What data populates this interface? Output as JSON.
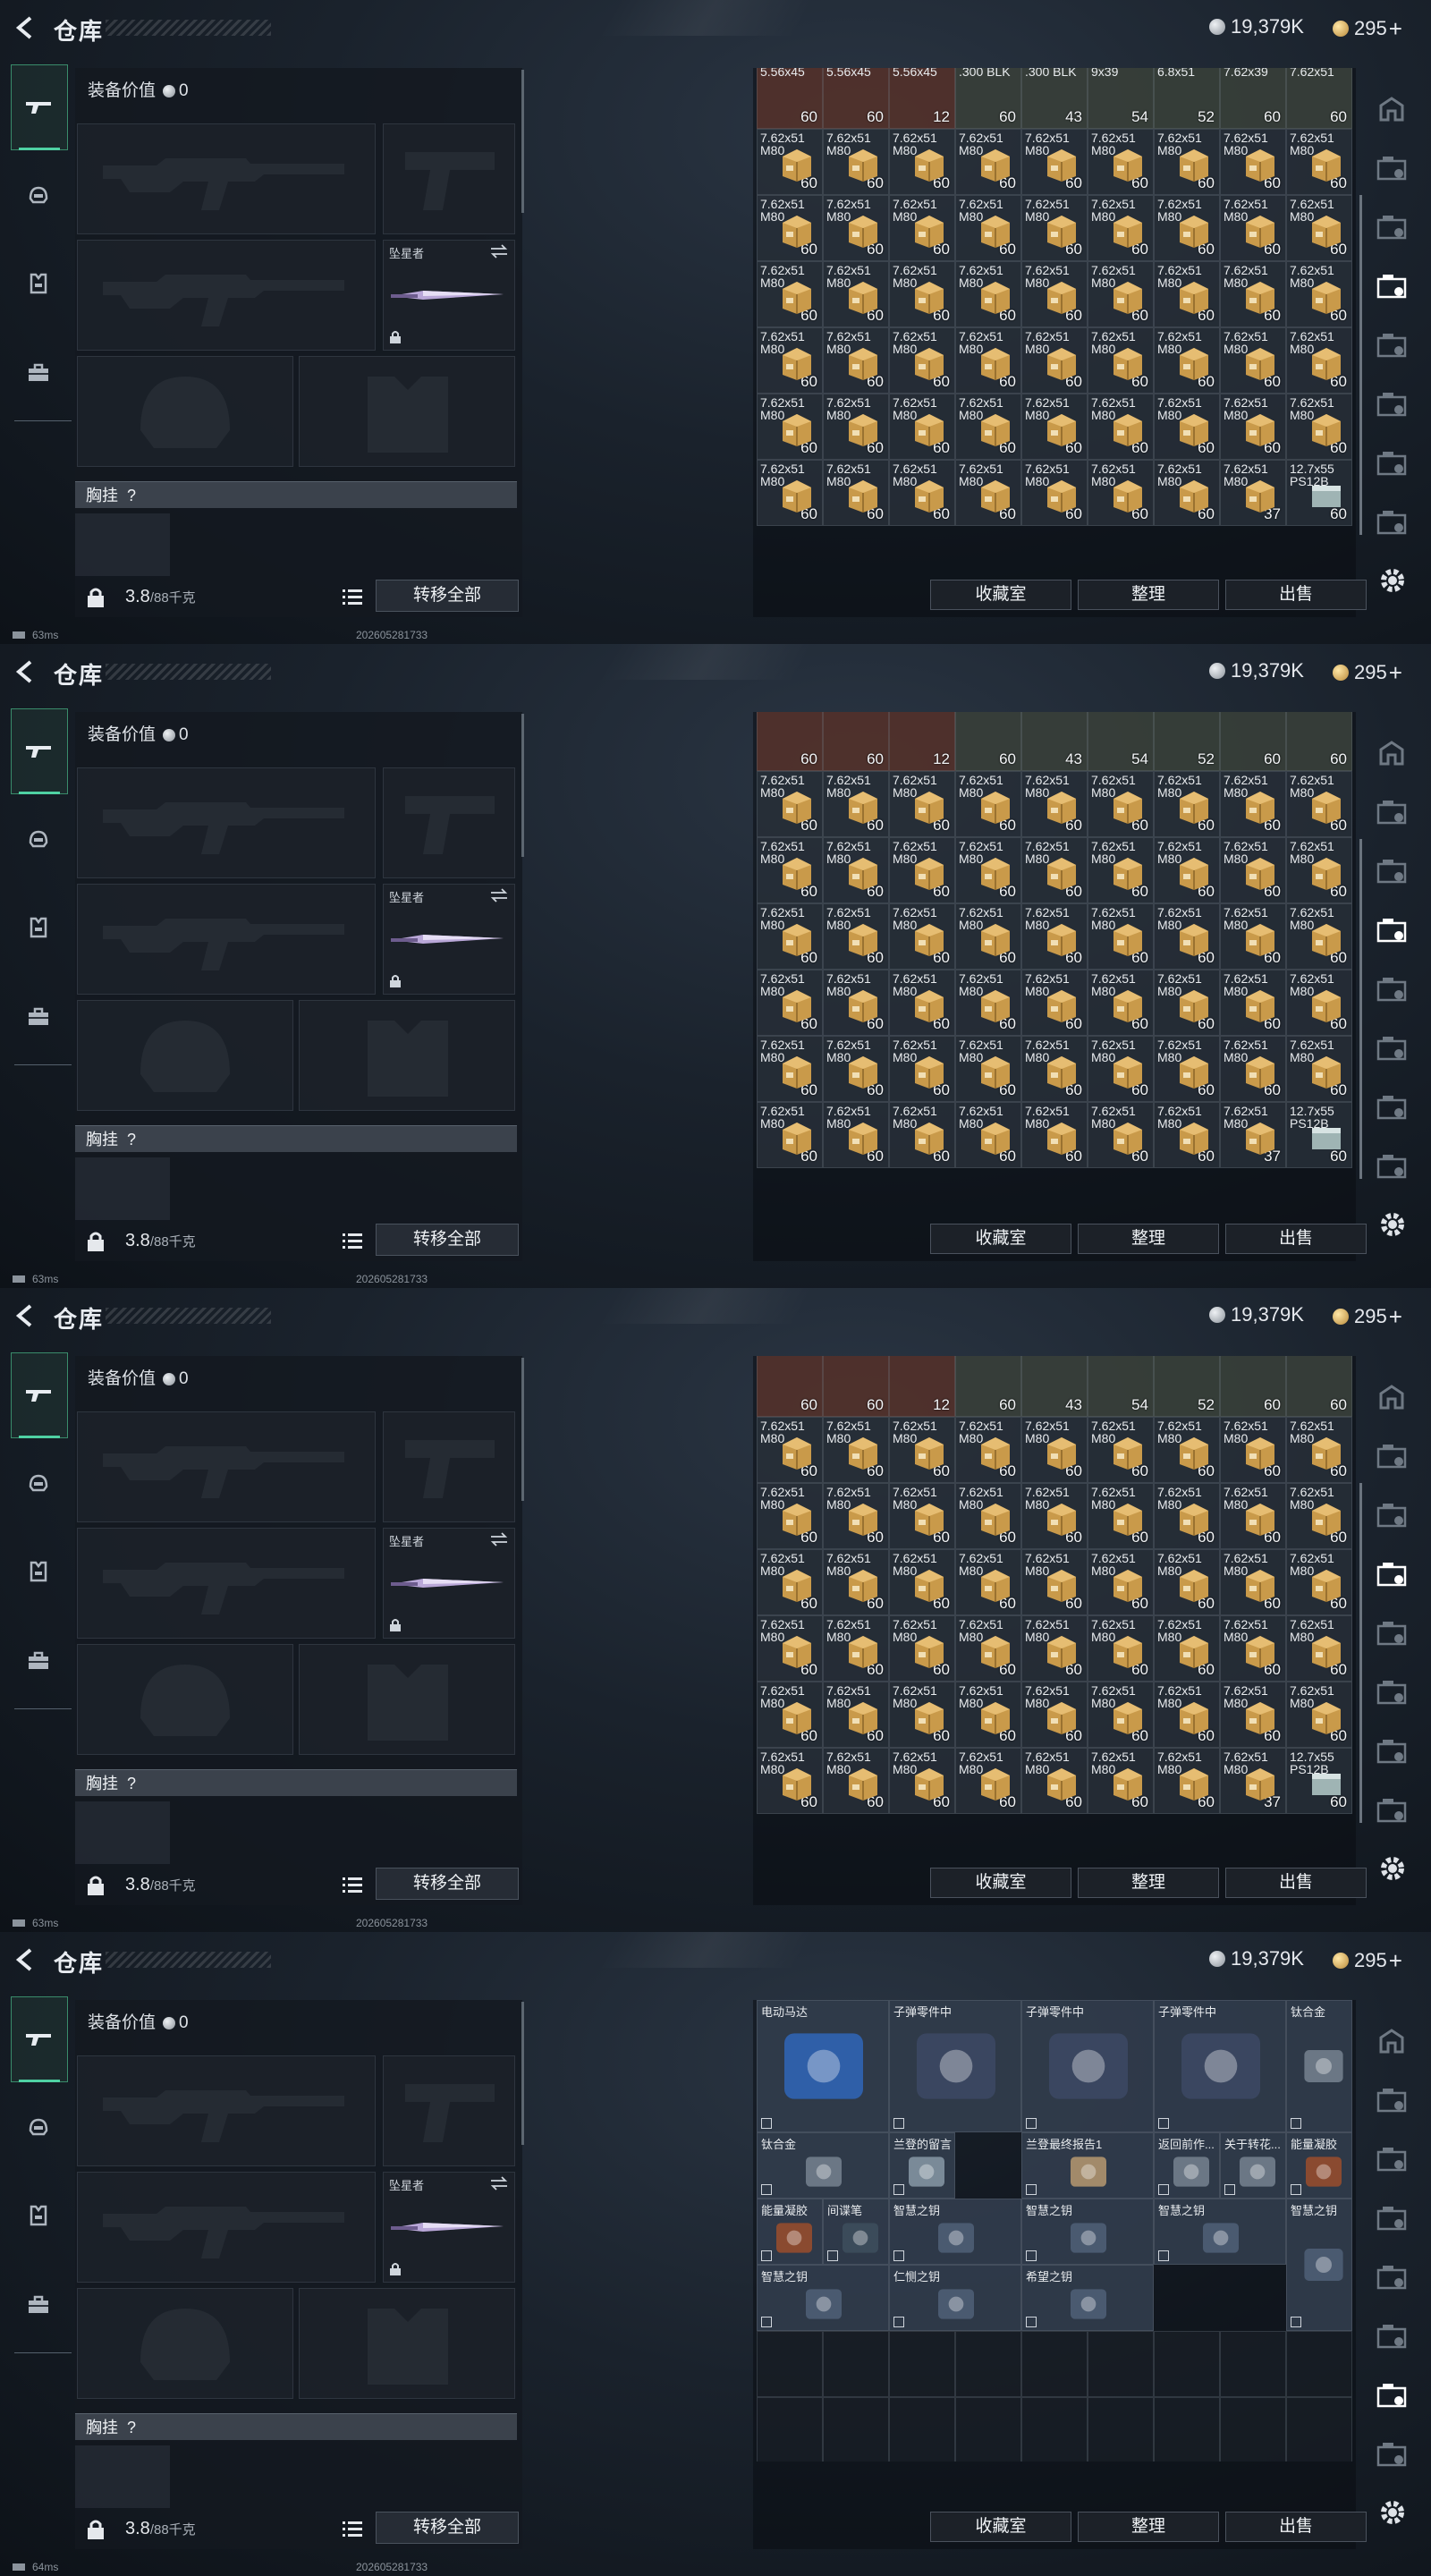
{
  "header": {
    "title": "仓库",
    "silver": "19,379K",
    "gold": "295",
    "plus": "+"
  },
  "loadout": {
    "equip_value_label": "装备价值",
    "equip_value": "0",
    "melee_name": "坠星者",
    "chest_label": "胸挂",
    "chest_help": "?",
    "weight": "3.8",
    "weight_cap": "/88千克",
    "transfer_all": "转移全部"
  },
  "buttons": {
    "collection": "收藏室",
    "sort": "整理",
    "sell": "出售"
  },
  "screens": [
    {
      "ping": "63ms",
      "stamp": "202605281733"
    },
    {
      "ping": "63ms",
      "stamp": "202605281733"
    },
    {
      "ping": "63ms",
      "stamp": "202605281733"
    },
    {
      "ping": "64ms",
      "stamp": "202605281733"
    }
  ],
  "ammo": {
    "name_line1": "7.62x51",
    "name_line2": "M80",
    "full_count": "60",
    "partial_count": "37",
    "last_name_line1": "12.7x55",
    "last_name_line2": "PS12B",
    "last_count": "60"
  },
  "ammo_top_row_1": [
    {
      "name": "5.56x45",
      "count": "60"
    },
    {
      "name": "5.56x45",
      "count": "60"
    },
    {
      "name": "5.56x45",
      "count": "12"
    },
    {
      "name": ".300 BLK",
      "count": "60"
    },
    {
      "name": ".300 BLK",
      "count": "43"
    },
    {
      "name": "9x39",
      "count": "54"
    },
    {
      "name": "6.8x51",
      "count": "52"
    },
    {
      "name": "7.62x39",
      "count": "60"
    },
    {
      "name": "7.62x51",
      "count": "60"
    }
  ],
  "stash_items": [
    {
      "name": "电动马达",
      "label_row": 0
    },
    {
      "name": "子弹零件中",
      "label_row": 0
    },
    {
      "name": "子弹零件中",
      "label_row": 0
    },
    {
      "name": "子弹零件中",
      "label_row": 0
    },
    {
      "name": "钛合金",
      "label_row": 0
    },
    {
      "name": "钛合金",
      "label_row": 1
    },
    {
      "name": "兰登的留言",
      "label_row": 1
    },
    {
      "name": "兰登最终报告1",
      "label_row": 1
    },
    {
      "name": "返回前作...",
      "label_row": 1
    },
    {
      "name": "关于转花...",
      "label_row": 1
    },
    {
      "name": "能量凝胶",
      "label_row": 1
    },
    {
      "name": "能量凝胶",
      "label_row": 2
    },
    {
      "name": "间谍笔",
      "label_row": 2
    },
    {
      "name": "智慧之钥",
      "label_row": 2
    },
    {
      "name": "智慧之钥",
      "label_row": 2
    },
    {
      "name": "智慧之钥",
      "label_row": 2
    },
    {
      "name": "智慧之钥",
      "label_row": 2
    },
    {
      "name": "智慧之钥",
      "label_row": 3
    },
    {
      "name": "仁恻之钥",
      "label_row": 3
    },
    {
      "name": "希望之钥",
      "label_row": 3
    }
  ],
  "right_tabs": [
    "home-icon",
    "stash-tab-1-icon",
    "stash-tab-2-icon",
    "stash-tab-3-icon",
    "stash-tab-4-icon",
    "stash-tab-5-icon",
    "stash-tab-6-icon",
    "stash-tab-7-icon"
  ],
  "colors": {
    "accent": "#4fd1a3",
    "panel": "#141920",
    "ammo_box": "#c99a4a"
  }
}
